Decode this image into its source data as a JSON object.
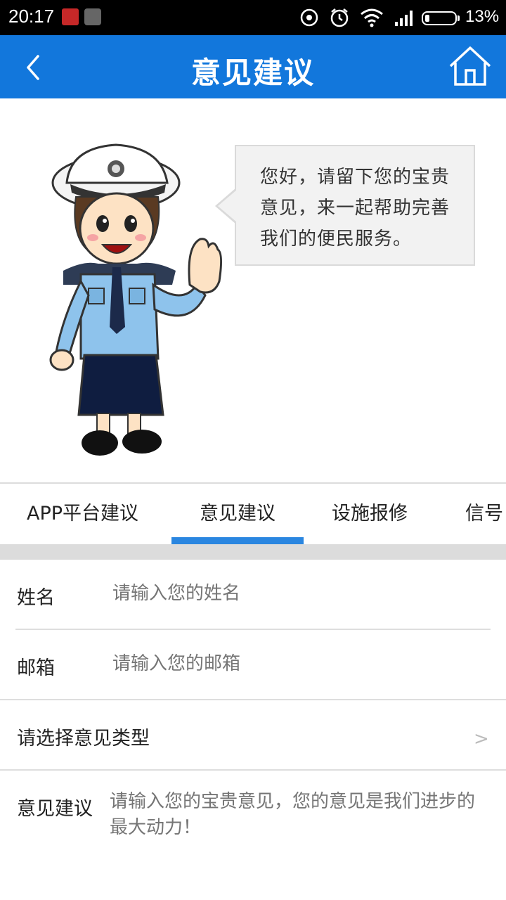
{
  "status_bar": {
    "time": "20:17",
    "battery_percent": "13%",
    "battery_level": 0.13,
    "icons": [
      "app-notification-icon",
      "app-notification-icon",
      "sync-icon",
      "alarm-icon",
      "wifi-icon",
      "cell-signal-icon",
      "battery-icon"
    ]
  },
  "header": {
    "title": "意见建议",
    "back_icon": "chevron-left-icon",
    "home_icon": "home-icon",
    "background_color": "#1277dc"
  },
  "hero": {
    "speech_bubble_text": "您好，请留下您的宝贵意见，来一起帮助完善我们的便民服务。"
  },
  "tabs": {
    "items": [
      {
        "label": "APP平台建议",
        "selected": false
      },
      {
        "label": "意见建议",
        "selected": true
      },
      {
        "label": "设施报修",
        "selected": false
      },
      {
        "label": "信号",
        "selected": false
      }
    ],
    "accent_color": "#2a86e0"
  },
  "form": {
    "name": {
      "label": "姓名",
      "placeholder": "请输入您的姓名"
    },
    "email": {
      "label": "邮箱",
      "placeholder": "请输入您的邮箱"
    },
    "type": {
      "label": "请选择意见类型",
      "chevron": ">"
    },
    "suggestion": {
      "label": "意见建议",
      "placeholder": "请输入您的宝贵意见，您的意见是我们进步的最大动力！"
    }
  }
}
